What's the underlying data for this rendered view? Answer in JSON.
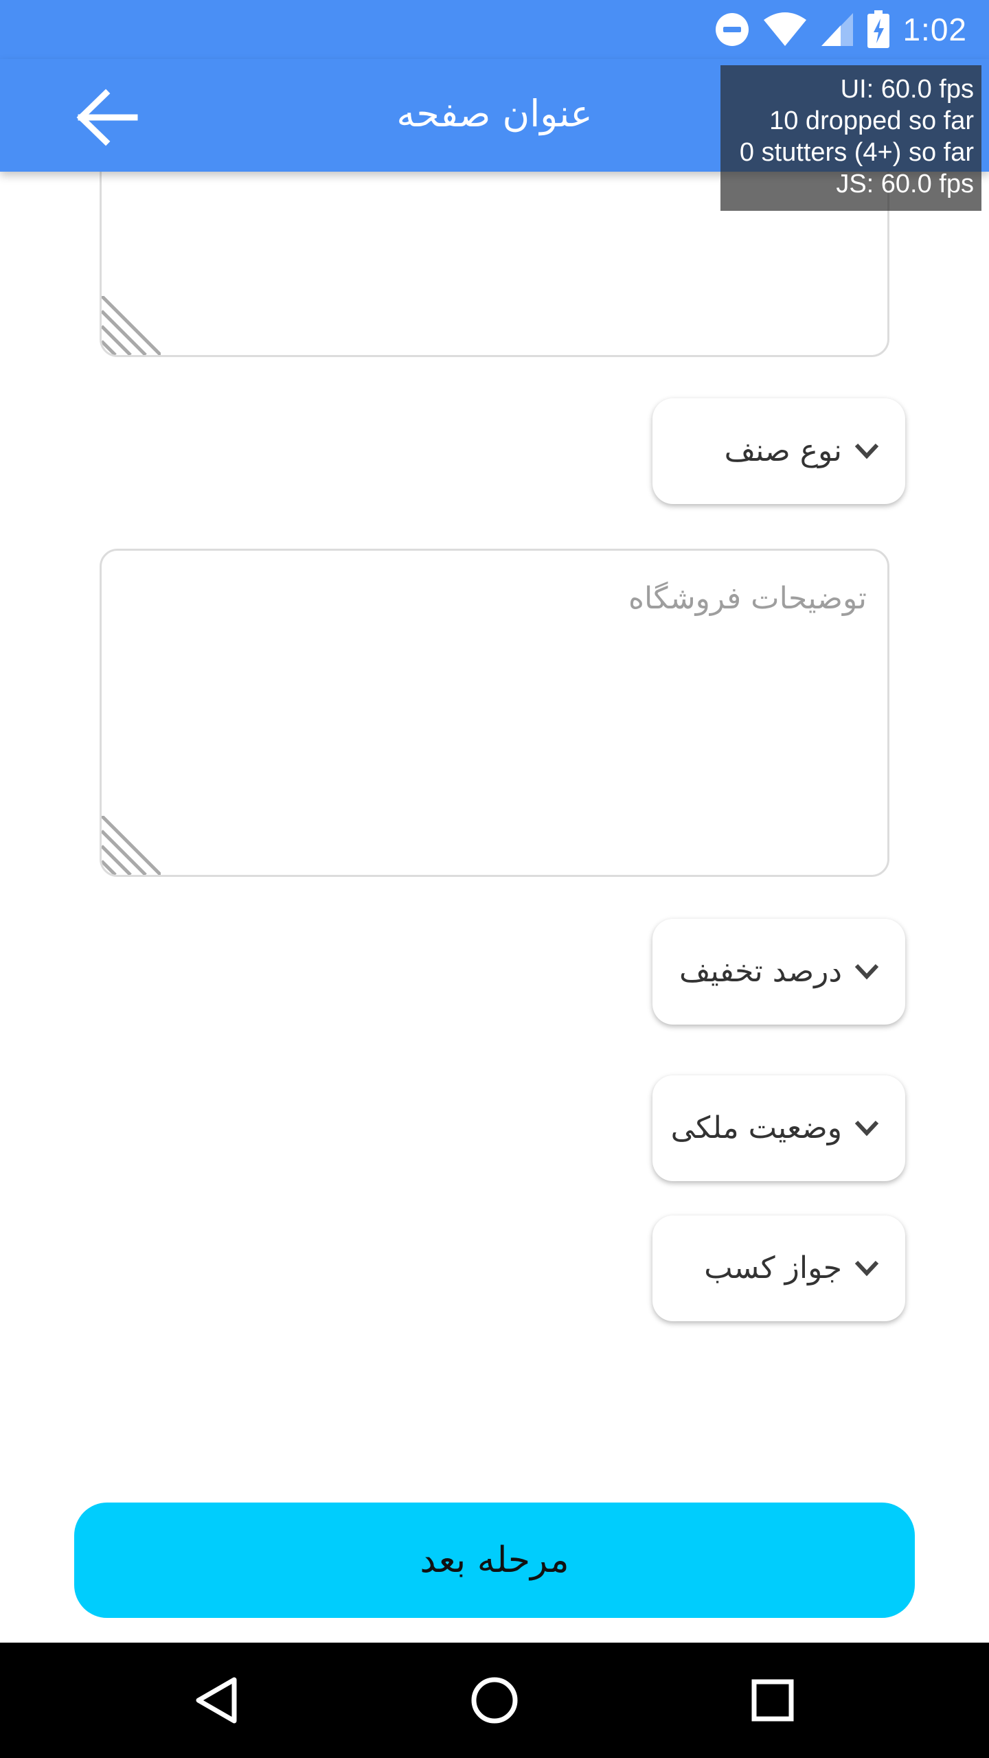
{
  "status_bar": {
    "time": "1:02",
    "icons": [
      "do-not-disturb-icon",
      "wifi-icon",
      "cell-signal-icon",
      "battery-charging-icon"
    ]
  },
  "app_bar": {
    "title": "عنوان صفحه",
    "back_icon": "arrow-back-icon"
  },
  "perf_monitor": {
    "ui_fps": "UI: 60.0 fps",
    "dropped": "10 dropped so far",
    "stutters": "0 stutters (4+) so far",
    "js_fps": "JS: 60.0 fps"
  },
  "form": {
    "store_description": {
      "placeholder": "توضیحات فروشگاه"
    },
    "dropdowns": {
      "category_type": "نوع صنف",
      "discount_percent": "درصد تخفیف",
      "ownership_status": "وضعیت ملکی",
      "business_license": "جواز کسب"
    },
    "next_button": "مرحله بعد"
  },
  "nav_bar": {
    "buttons": [
      "back-triangle-icon",
      "home-circle-icon",
      "recents-square-icon"
    ]
  },
  "colors": {
    "primary": "#4a8ff5",
    "accent_button": "#00cdfd",
    "border": "#dcdcdc"
  }
}
